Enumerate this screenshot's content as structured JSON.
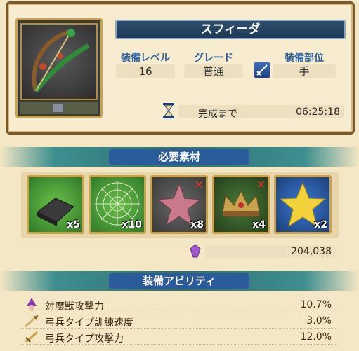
{
  "item": {
    "name": "スフィーダ",
    "icon": "serpent-bow-icon"
  },
  "stats": {
    "level_label": "装備レベル",
    "level_value": "16",
    "grade_label": "グレード",
    "grade_value": "普通",
    "slot_label": "装備部位",
    "slot_value": "手",
    "slot_icon": "sword-icon"
  },
  "timer": {
    "label": "完成まで",
    "value": "06:25:18",
    "icon": "hourglass-icon"
  },
  "materials": {
    "title": "必要素材",
    "items": [
      {
        "icon": "iron-ingot-icon",
        "qty": "x5",
        "missing": false
      },
      {
        "icon": "spider-web-icon",
        "qty": "x10",
        "missing": false
      },
      {
        "icon": "star-shuriken-icon",
        "qty": "x8",
        "missing": true
      },
      {
        "icon": "crown-icon",
        "qty": "x4",
        "missing": true
      },
      {
        "icon": "gold-star-icon",
        "qty": "x2",
        "missing": false
      }
    ],
    "missing_mark": "✕"
  },
  "cost": {
    "value": "204,038",
    "icon": "crystal-icon"
  },
  "abilities": {
    "title": "装備アビリティ",
    "rows": [
      {
        "label": "対魔獣攻撃力",
        "value": "10.7%",
        "icon": "witch-icon"
      },
      {
        "label": "弓兵タイプ訓練速度",
        "value": "3.0%",
        "icon": "arrow-icon"
      },
      {
        "label": "弓兵タイプ攻撃力",
        "value": "12.0%",
        "icon": "sword-icon"
      }
    ]
  },
  "colors": {
    "accent_blue": "#2c5b9c",
    "teal_banner": "#2f6f73",
    "gold_frame": "#c9a24e"
  }
}
